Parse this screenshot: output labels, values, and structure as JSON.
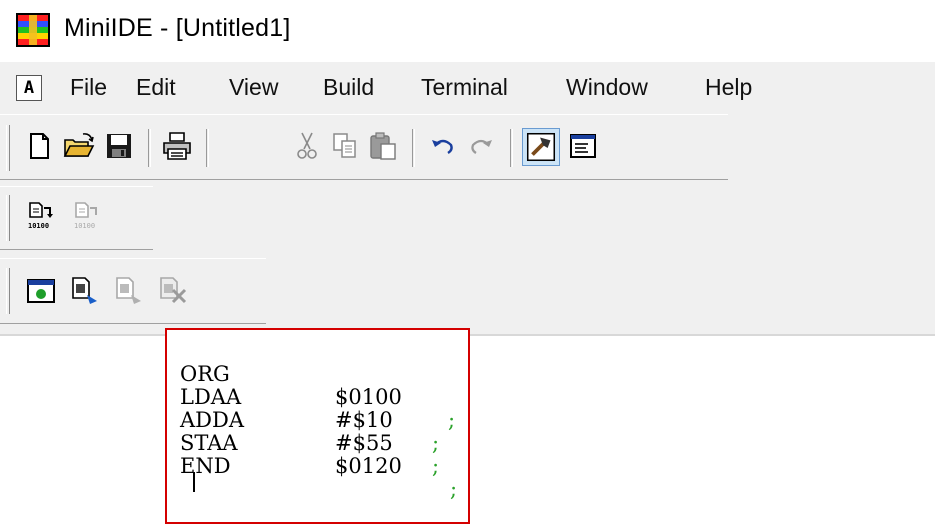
{
  "window": {
    "title": "MiniIDE - [Untitled1]",
    "icon": "miniide-app-icon"
  },
  "menu": {
    "system_icon_label": "A",
    "items": [
      "File",
      "Edit",
      "View",
      "Build",
      "Terminal",
      "Window",
      "Help"
    ]
  },
  "toolbars": {
    "standard": [
      "new-file-icon",
      "open-folder-icon",
      "save-icon",
      "print-icon",
      "cut-icon",
      "copy-icon",
      "paste-icon",
      "undo-icon",
      "redo-icon",
      "build-icon",
      "output-window-icon"
    ],
    "compile": [
      "assemble-icon",
      "assemble-disabled-icon"
    ],
    "download": [
      "terminal-window-icon",
      "download-icon",
      "download-disabled-icon",
      "stop-download-icon"
    ],
    "pressed_button": "build-icon"
  },
  "editor": {
    "lines": [
      {
        "op": "ORG",
        "arg": "$0100",
        "comment": ";"
      },
      {
        "op": "LDAA",
        "arg": "#$10",
        "comment": ";"
      },
      {
        "op": "ADDA",
        "arg": "#$55",
        "comment": ";"
      },
      {
        "op": "STAA",
        "arg": "$0120",
        "comment": ";"
      },
      {
        "op": "END",
        "arg": "",
        "comment": ""
      }
    ],
    "highlight_color": "#d40000",
    "comment_color": "#2aa12a"
  }
}
